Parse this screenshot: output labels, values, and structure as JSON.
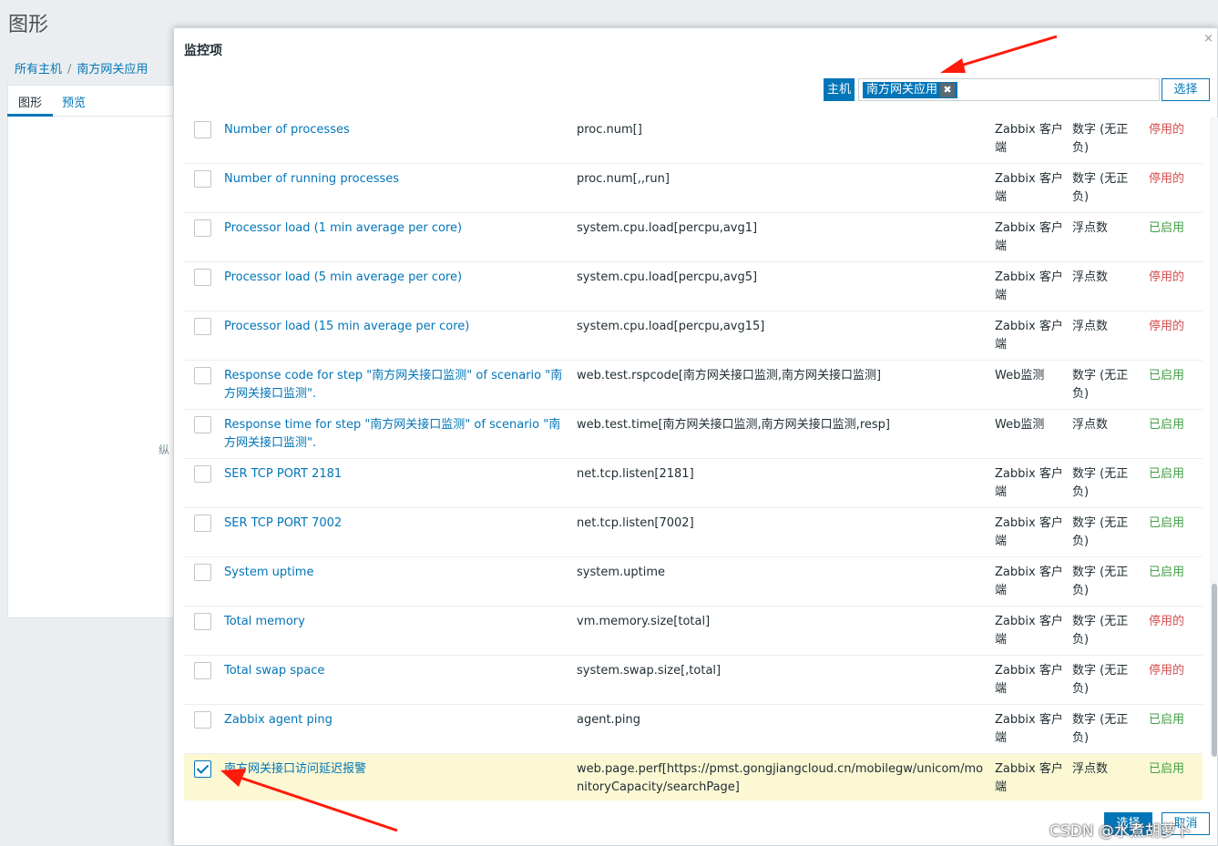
{
  "background": {
    "title": "图形",
    "breadcrumb": [
      "所有主机",
      "南方网关应用"
    ],
    "tabs": [
      "图形",
      "预览"
    ],
    "fragment": "纵"
  },
  "modal": {
    "title": "监控项",
    "close_icon": "×",
    "host_label": "主机",
    "host_chip": "南方网关应用",
    "chip_remove": "✖",
    "select_label": "选择",
    "footer": {
      "select": "选择",
      "cancel": "取消"
    }
  },
  "rows": [
    {
      "name": "Number of processes",
      "key": "proc.num[]",
      "type": "Zabbix 客户端",
      "value_type": "数字 (无正负)",
      "status": "停用的",
      "checked": false
    },
    {
      "name": "Number of running processes",
      "key": "proc.num[,,run]",
      "type": "Zabbix 客户端",
      "value_type": "数字 (无正负)",
      "status": "停用的",
      "checked": false
    },
    {
      "name": "Processor load (1 min average per core)",
      "key": "system.cpu.load[percpu,avg1]",
      "type": "Zabbix 客户端",
      "value_type": "浮点数",
      "status": "已启用",
      "checked": false
    },
    {
      "name": "Processor load (5 min average per core)",
      "key": "system.cpu.load[percpu,avg5]",
      "type": "Zabbix 客户端",
      "value_type": "浮点数",
      "status": "停用的",
      "checked": false
    },
    {
      "name": "Processor load (15 min average per core)",
      "key": "system.cpu.load[percpu,avg15]",
      "type": "Zabbix 客户端",
      "value_type": "浮点数",
      "status": "停用的",
      "checked": false
    },
    {
      "name": "Response code for step \"南方网关接口监测\" of scenario \"南方网关接口监测\".",
      "key": "web.test.rspcode[南方网关接口监测,南方网关接口监测]",
      "type": "Web监测",
      "value_type": "数字 (无正负)",
      "status": "已启用",
      "checked": false
    },
    {
      "name": "Response time for step \"南方网关接口监测\" of scenario \"南方网关接口监测\".",
      "key": "web.test.time[南方网关接口监测,南方网关接口监测,resp]",
      "type": "Web监测",
      "value_type": "浮点数",
      "status": "已启用",
      "checked": false
    },
    {
      "name": "SER TCP PORT 2181",
      "key": "net.tcp.listen[2181]",
      "type": "Zabbix 客户端",
      "value_type": "数字 (无正负)",
      "status": "已启用",
      "checked": false
    },
    {
      "name": "SER TCP PORT 7002",
      "key": "net.tcp.listen[7002]",
      "type": "Zabbix 客户端",
      "value_type": "数字 (无正负)",
      "status": "已启用",
      "checked": false
    },
    {
      "name": "System uptime",
      "key": "system.uptime",
      "type": "Zabbix 客户端",
      "value_type": "数字 (无正负)",
      "status": "已启用",
      "checked": false
    },
    {
      "name": "Total memory",
      "key": "vm.memory.size[total]",
      "type": "Zabbix 客户端",
      "value_type": "数字 (无正负)",
      "status": "停用的",
      "checked": false
    },
    {
      "name": "Total swap space",
      "key": "system.swap.size[,total]",
      "type": "Zabbix 客户端",
      "value_type": "数字 (无正负)",
      "status": "停用的",
      "checked": false
    },
    {
      "name": "Zabbix agent ping",
      "key": "agent.ping",
      "type": "Zabbix 客户端",
      "value_type": "数字 (无正负)",
      "status": "已启用",
      "checked": false
    },
    {
      "name": "南方网关接口访问延迟报警",
      "key": "web.page.perf[https://pmst.gongjiangcloud.cn/mobilegw/unicom/monitoryCapacity/searchPage]",
      "type": "Zabbix 客户端",
      "value_type": "浮点数",
      "status": "已启用",
      "checked": true
    }
  ],
  "status_colors": {
    "已启用": "#429e47",
    "停用的": "#d64e4e"
  },
  "accent_color": "#0275b8",
  "watermark": "CSDN @水煮胡萝卜"
}
